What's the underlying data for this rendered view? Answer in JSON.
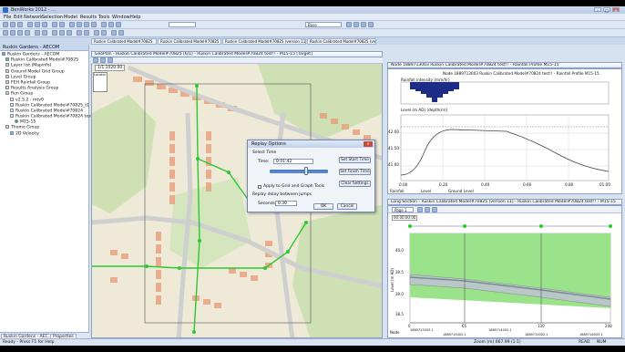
{
  "window": {
    "title": "BenWorks 2012 - ...",
    "controls": [
      "–",
      "□",
      "✕"
    ]
  },
  "menu": [
    "File",
    "Edit",
    "Network",
    "Selection",
    "Model",
    "Results",
    "Tools",
    "Window",
    "Help"
  ],
  "toolbar": {
    "combo_base": "Base",
    "combo_query": ""
  },
  "tabs": [
    "Ruskin Calibrated Model#70825",
    "Ruskin Calibrated Model#70825 (version 11)",
    "Ruskin Calibrated Model#70825 (version 11) - Total Storag",
    "Ruskin Calibrated Model#70825 (version 11)"
  ],
  "left_panel": {
    "title": "Ruskin Gardens - AECOM",
    "tree": [
      "Ruskin Gardens - AECOM",
      "Ruskin Calibrated Model#70825",
      "Layer list (Mapinfo)",
      "Ground Model Grid Group",
      "Level Group",
      "FEH Rainfall Group",
      "Results Analysis Group",
      "Run Group",
      "v2.5.2 - mtv0",
      "Ruskin Calibrated Model#70825_t1",
      "Ruskin Calibrated Model#70824",
      "Ruskin Calibrated Model#70824 test!!",
      "M15-15",
      "Theme Group",
      "2D Velocity"
    ],
    "bottom_tabs": [
      "Ruskin Gardens - AEC...",
      "Properties"
    ]
  },
  "map": {
    "title": "GeoPlan - Ruskin Calibrated Model#70825 (6/1) - Ruskin Calibrated Model#70824 test!! - M15-15  [Target]",
    "zoom_label": "1/1 1020.00",
    "overview_label": "Locator"
  },
  "graph_window": {
    "title": "Node 1889713003 Ruskin Calibrated Model#70824 test!! - Rainfall Profile M15-15",
    "header": "Node 1889713003 Ruskin Calibrated Model#70824 test!! - Rainfall Profile M15-15",
    "rainfall_label": "Rainfall intensity (mm/hr)",
    "level_label": "Level (m AD) (depth(m))",
    "y_ticks": [
      "42.00",
      "41.50",
      "41.00"
    ],
    "x_ticks": [
      "0.00",
      "0.20",
      "0.40",
      "0.60",
      "0.80",
      "01.00"
    ],
    "legend": [
      "Rainfall",
      "Level",
      "Ground Level"
    ]
  },
  "long_section": {
    "title": "Long Section - Ruskin Calibrated Model#70825 (version 11) - Ruskin Calibrated Model#70824 test!! - M15-15",
    "page_combo": "Page 1",
    "time_display": "00:00:00:00",
    "y_axis_label": "Level (m AD)",
    "y_ticks": [
      "40.0",
      "39.5",
      "39.0",
      "38.5"
    ],
    "x_labels": [
      "0",
      "65",
      "130",
      "240"
    ],
    "node_row_label": "Node",
    "node_ids": [
      "1889713003.1",
      "1889715002.1",
      "1889714002.1",
      "1889715002.1",
      "1889716003.1"
    ]
  },
  "dialog": {
    "title": "Replay Options",
    "close": "✕",
    "select_time_label": "Select Time",
    "time_label": "Time:",
    "time_value": "0:01:42",
    "set_start_time": "Set Start Time",
    "set_finish_time": "Set Finish Time",
    "clear_settings": "Clear Settings",
    "apply_checkbox": "Apply to Grid and Graph Tools",
    "replay_delay_label": "Replay delay between jumps",
    "seconds_label": "Seconds:",
    "seconds_value": "0.30",
    "ok": "OK",
    "cancel": "Cancel",
    "slider_fraction": 0.62
  },
  "status": {
    "left": "Ready - Press F1 for Help",
    "zoom": "Zoom (m) 667.99 (1:1)",
    "read": "READ",
    "num": "NUM"
  },
  "colors": {
    "map_background": "#f2efe6",
    "building": "#e89a74",
    "green_area": "#b9d59a",
    "road": "#d3d3d3",
    "pipe": "#2ec733",
    "rainfall_bar": "#1d2c87",
    "section_fill": "#9be38a",
    "dialog_border": "#6f88b4"
  }
}
